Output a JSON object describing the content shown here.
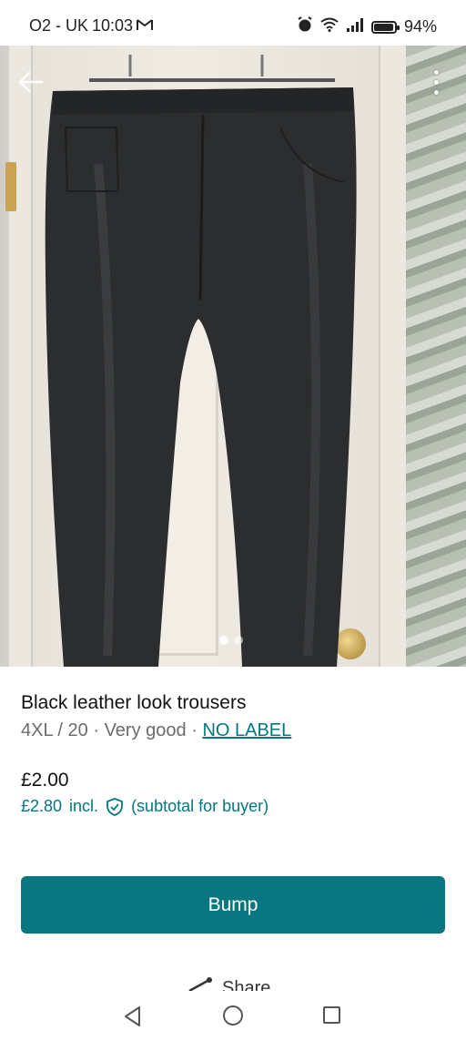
{
  "status_bar": {
    "carrier": "O2 - UK",
    "time": "10:03",
    "battery_percent": "94%",
    "battery_level": 0.94,
    "icons": [
      "gmail-icon",
      "alarm-icon",
      "wifi-icon",
      "signal-icon",
      "battery-icon"
    ]
  },
  "photo": {
    "page_indicator": {
      "count": 2,
      "active_index": 0
    }
  },
  "item": {
    "title": "Black leather look trousers",
    "size": "4XL / 20",
    "separator_1": "·",
    "condition": "Very good",
    "separator_2": "·",
    "brand": "NO LABEL",
    "price": "£2.00",
    "buyer_price": "£2.80",
    "incl_label": "incl.",
    "buyer_note": "(subtotal for buyer)"
  },
  "actions": {
    "bump_label": "Bump",
    "share_label": "Share"
  },
  "colors": {
    "accent": "#007782",
    "button": "#09777f"
  }
}
